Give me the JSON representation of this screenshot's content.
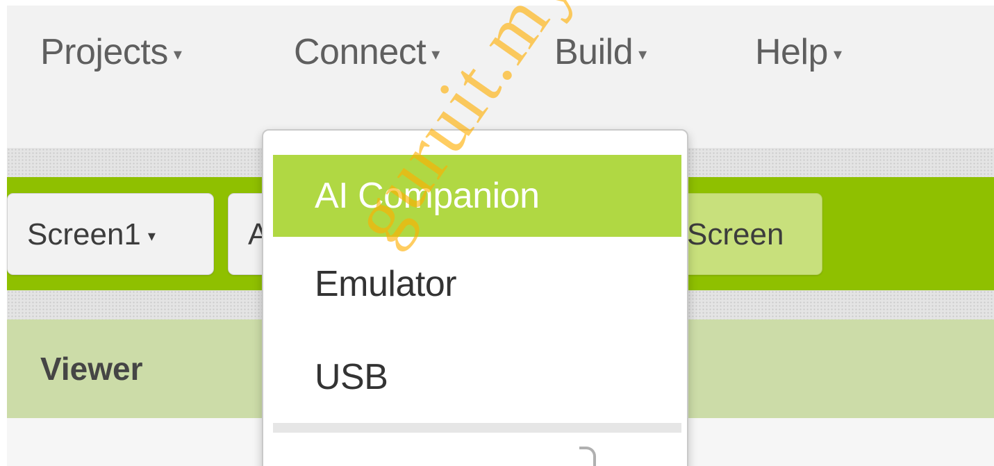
{
  "menubar": {
    "items": [
      {
        "label": "Projects",
        "caret": "▾"
      },
      {
        "label": "Connect",
        "caret": "▾"
      },
      {
        "label": "Build",
        "caret": "▾"
      },
      {
        "label": "Help",
        "caret": "▾"
      }
    ]
  },
  "toolbar": {
    "screen_select_label": "Screen1",
    "screen_select_caret": "▾",
    "add_screen_label": "A",
    "remove_screen_label": "Screen"
  },
  "viewer": {
    "title": "Viewer"
  },
  "connect_menu": {
    "items": [
      {
        "label": "AI Companion",
        "highlighted": true
      },
      {
        "label": "Emulator"
      },
      {
        "label": "USB"
      }
    ]
  },
  "watermark": {
    "text": "guruit.my"
  },
  "colors": {
    "toolbar_green": "#8fc000",
    "highlight_green": "#b0d843",
    "viewer_header": "#ccdca8",
    "watermark": "#ffaf00"
  }
}
